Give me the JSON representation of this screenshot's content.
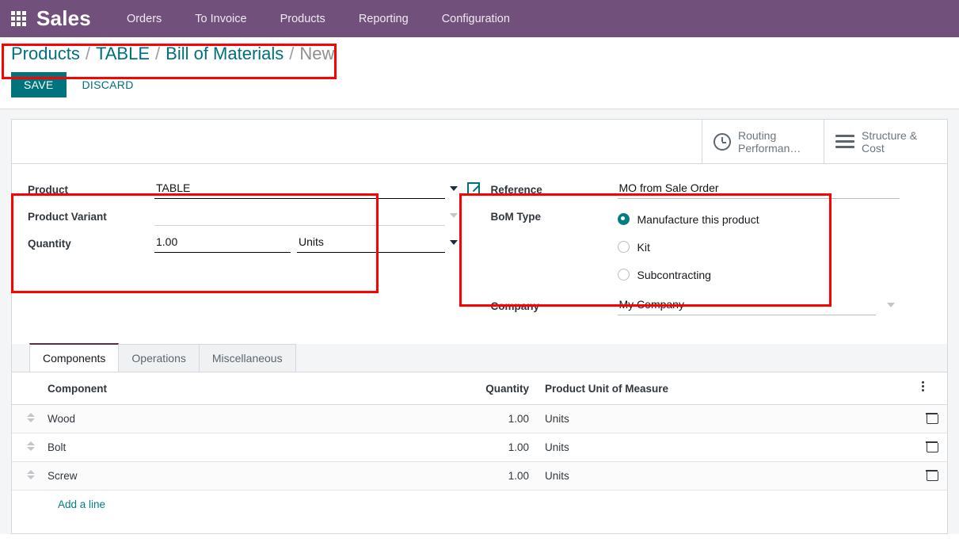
{
  "navbar": {
    "apps_icon": "apps-grid-icon",
    "brand": "Sales",
    "items": [
      {
        "label": "Orders"
      },
      {
        "label": "To Invoice"
      },
      {
        "label": "Products"
      },
      {
        "label": "Reporting"
      },
      {
        "label": "Configuration"
      }
    ]
  },
  "breadcrumb": {
    "items": [
      {
        "label": "Products",
        "current": false
      },
      {
        "label": "TABLE",
        "current": false
      },
      {
        "label": "Bill of Materials",
        "current": false
      },
      {
        "label": "New",
        "current": true
      }
    ],
    "separator": "/"
  },
  "actions": {
    "save_label": "SAVE",
    "discard_label": "DISCARD"
  },
  "stat_buttons": [
    {
      "icon": "clock-icon",
      "label": "Routing Performan…"
    },
    {
      "icon": "bars-icon",
      "label": "Structure & Cost"
    }
  ],
  "form": {
    "left": {
      "product": {
        "label": "Product",
        "value": "TABLE",
        "external_link_icon": "external-link-icon",
        "caret_icon": "chevron-down-icon"
      },
      "product_variant": {
        "label": "Product Variant",
        "value": "",
        "placeholder": "",
        "caret_icon": "chevron-down-icon"
      },
      "quantity": {
        "label": "Quantity",
        "value": "1.00",
        "uom_value": "Units",
        "caret_icon": "chevron-down-icon"
      }
    },
    "right": {
      "reference": {
        "label": "Reference",
        "value": "MO from Sale Order"
      },
      "bom_type": {
        "label": "BoM Type",
        "options": [
          {
            "label": "Manufacture this product",
            "selected": true
          },
          {
            "label": "Kit",
            "selected": false
          },
          {
            "label": "Subcontracting",
            "selected": false
          }
        ]
      },
      "company": {
        "label": "Company",
        "value": "My Company",
        "caret_icon": "chevron-down-icon"
      }
    }
  },
  "notebook": {
    "tabs": [
      {
        "label": "Components",
        "active": true
      },
      {
        "label": "Operations",
        "active": false
      },
      {
        "label": "Miscellaneous",
        "active": false
      }
    ]
  },
  "components_table": {
    "columns": {
      "component": "Component",
      "quantity": "Quantity",
      "uom": "Product Unit of Measure"
    },
    "options_icon": "vertical-dots-icon",
    "rows": [
      {
        "component": "Wood",
        "quantity": "1.00",
        "uom": "Units",
        "drag_icon": "drag-handle-icon",
        "delete_icon": "trash-icon"
      },
      {
        "component": "Bolt",
        "quantity": "1.00",
        "uom": "Units",
        "drag_icon": "drag-handle-icon",
        "delete_icon": "trash-icon"
      },
      {
        "component": "Screw",
        "quantity": "1.00",
        "uom": "Units",
        "drag_icon": "drag-handle-icon",
        "delete_icon": "trash-icon"
      }
    ],
    "add_line_label": "Add a line"
  },
  "colors": {
    "brand_purple": "#71517c",
    "accent_teal": "#017e84",
    "link_teal": "#00707f",
    "highlight_red": "#ff0000",
    "active_tab_border": "#5a2b42"
  }
}
